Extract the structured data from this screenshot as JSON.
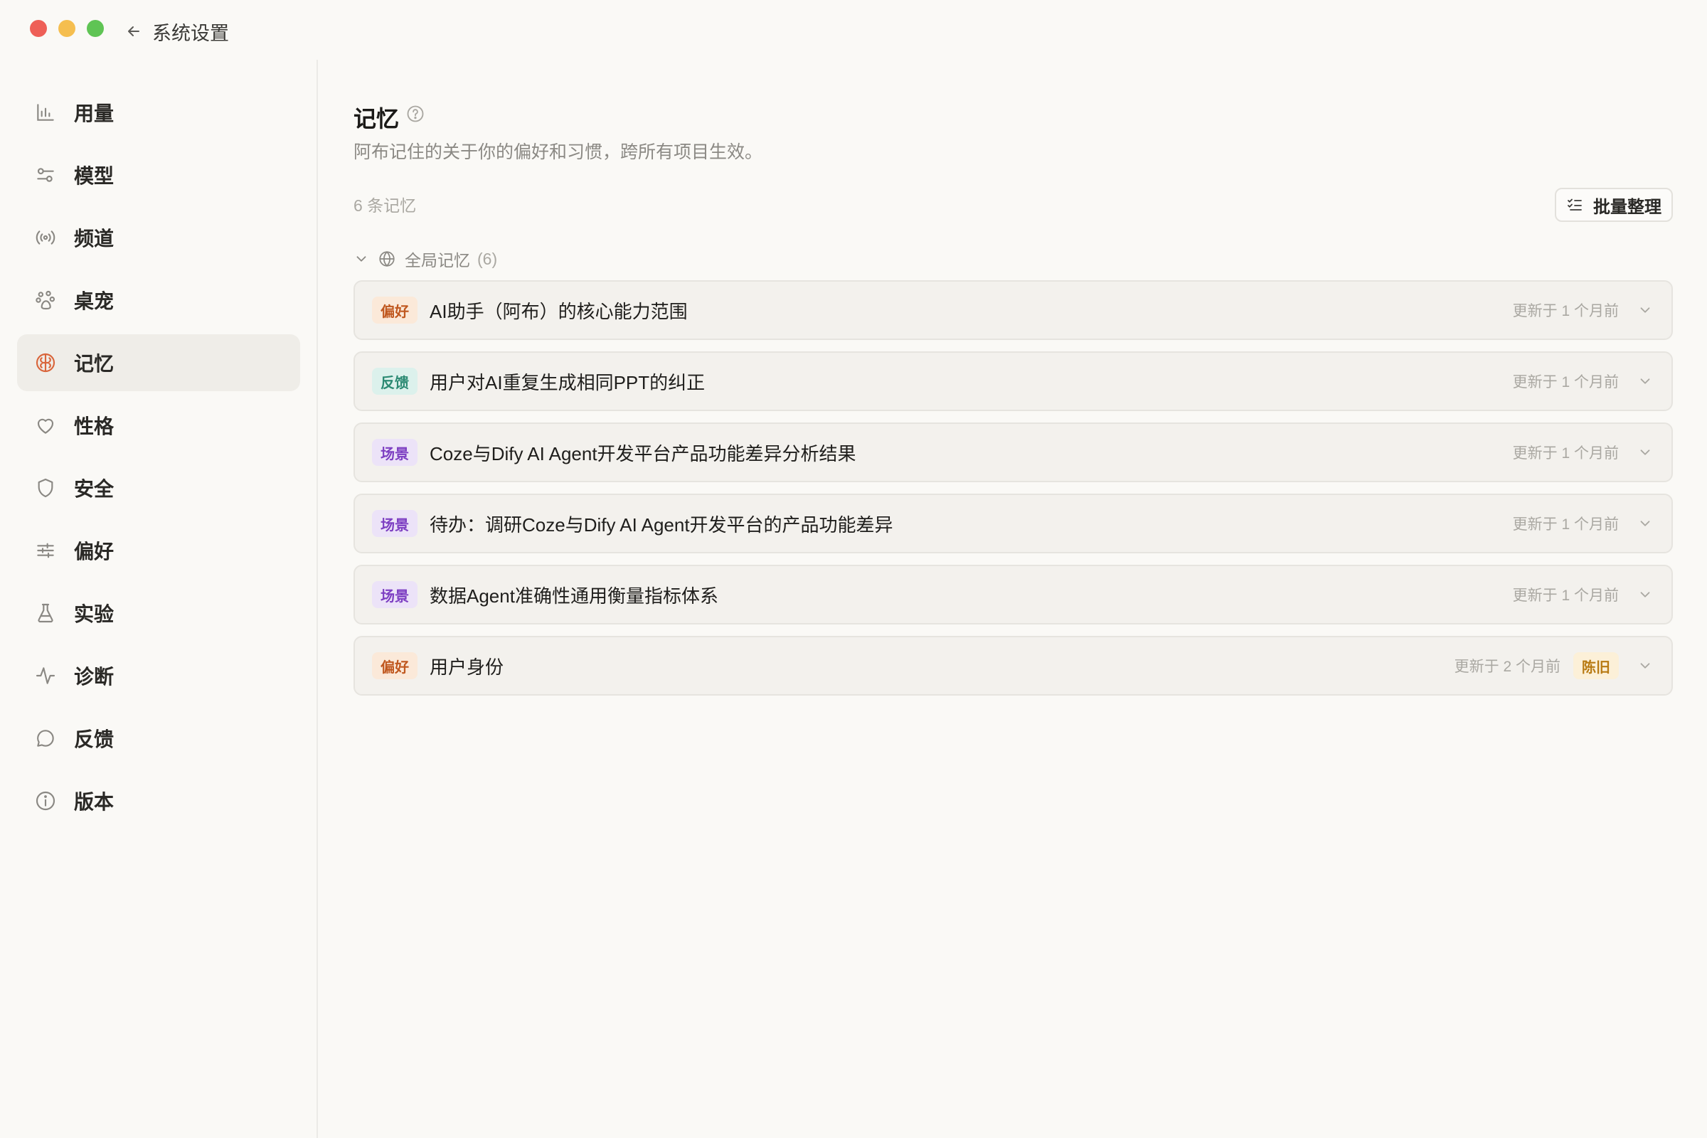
{
  "titlebar": {
    "back_label": "系统设置"
  },
  "sidebar": {
    "items": [
      {
        "label": "用量",
        "icon": "bar-chart-icon"
      },
      {
        "label": "模型",
        "icon": "sliders-toggle-icon"
      },
      {
        "label": "频道",
        "icon": "broadcast-icon"
      },
      {
        "label": "桌宠",
        "icon": "paw-icon"
      },
      {
        "label": "记忆",
        "icon": "brain-icon",
        "active": true
      },
      {
        "label": "性格",
        "icon": "heart-icon"
      },
      {
        "label": "安全",
        "icon": "shield-icon"
      },
      {
        "label": "偏好",
        "icon": "adjustments-icon"
      },
      {
        "label": "实验",
        "icon": "flask-icon"
      },
      {
        "label": "诊断",
        "icon": "activity-icon"
      },
      {
        "label": "反馈",
        "icon": "chat-bubble-icon"
      },
      {
        "label": "版本",
        "icon": "info-icon"
      }
    ]
  },
  "main": {
    "title": "记忆",
    "subtitle": "阿布记住的关于你的偏好和习惯，跨所有项目生效。",
    "count_label": "6 条记忆",
    "batch_button": "批量整理",
    "group": {
      "label": "全局记忆",
      "count": "(6)"
    },
    "memories": [
      {
        "tag": "偏好",
        "tag_type": "pref",
        "title": "AI助手（阿布）的核心能力范围",
        "updated": "更新于 1 个月前"
      },
      {
        "tag": "反馈",
        "tag_type": "feedback",
        "title": "用户对AI重复生成相同PPT的纠正",
        "updated": "更新于 1 个月前"
      },
      {
        "tag": "场景",
        "tag_type": "scene",
        "title": "Coze与Dify AI Agent开发平台产品功能差异分析结果",
        "updated": "更新于 1 个月前"
      },
      {
        "tag": "场景",
        "tag_type": "scene",
        "title": "待办：调研Coze与Dify AI Agent开发平台的产品功能差异",
        "updated": "更新于 1 个月前"
      },
      {
        "tag": "场景",
        "tag_type": "scene",
        "title": "数据Agent准确性通用衡量指标体系",
        "updated": "更新于 1 个月前"
      },
      {
        "tag": "偏好",
        "tag_type": "pref",
        "title": "用户身份",
        "updated": "更新于 2 个月前",
        "stale": "陈旧"
      }
    ]
  },
  "colors": {
    "background": "#faf9f6",
    "accent": "#d9653b",
    "tag_pref": "#c0581f",
    "tag_feedback": "#2c8a73",
    "tag_scene": "#7d3fc2",
    "stale": "#b87a12"
  }
}
